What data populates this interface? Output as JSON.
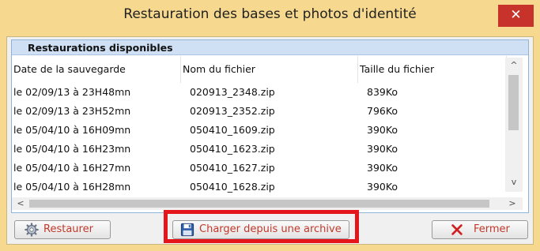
{
  "window": {
    "title": "Restauration des bases et photos d'identité",
    "close_glyph": "✕"
  },
  "group": {
    "title": "Restaurations disponibles"
  },
  "list": {
    "columns": [
      "Date de la sauvegarde",
      "Nom du fichier",
      "Taille du fichier"
    ],
    "rows": [
      [
        "le 02/09/13 à 23H48mn",
        "020913_2348.zip",
        "839Ko"
      ],
      [
        "le 02/09/13 à 23H52mn",
        "020913_2352.zip",
        "796Ko"
      ],
      [
        "le 05/04/10 à 16H09mn",
        "050410_1609.zip",
        "390Ko"
      ],
      [
        "le 05/04/10 à 16H23mn",
        "050410_1623.zip",
        "390Ko"
      ],
      [
        "le 05/04/10 à 16H27mn",
        "050410_1627.zip",
        "390Ko"
      ],
      [
        "le 05/04/10 à 16H28mn",
        "050410_1628.zip",
        "390Ko"
      ]
    ]
  },
  "scroll": {
    "up": "^",
    "down": "v",
    "left": "<",
    "right": ">"
  },
  "buttons": {
    "restore": {
      "label": "Restaurer",
      "icon": "gear-icon"
    },
    "load": {
      "label": "Charger depuis une archive",
      "icon": "floppy-disk-icon"
    },
    "close": {
      "label": "Fermer",
      "icon": "red-x-icon"
    }
  },
  "colors": {
    "title_bar": "#f6d98f",
    "close": "#c7322b",
    "group_header": "#cfe0f4",
    "highlight": "#e4151b",
    "button_text": "#c0392b"
  }
}
